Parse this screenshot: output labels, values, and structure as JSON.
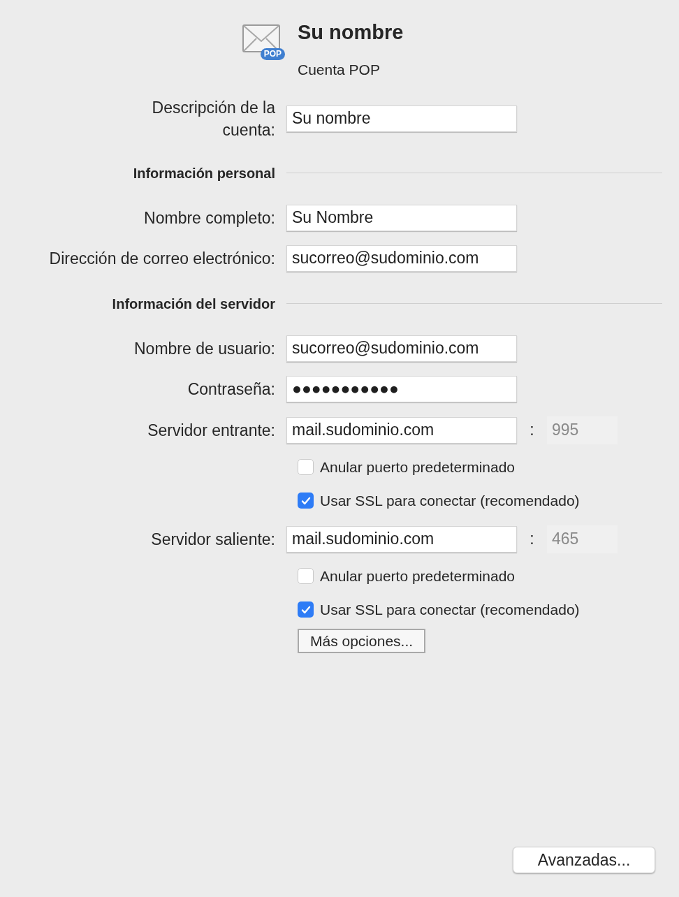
{
  "header": {
    "badge": "POP",
    "title": "Su nombre",
    "subtitle": "Cuenta POP"
  },
  "rows": [
    {
      "kind": "text",
      "label": [
        "Descripción de la",
        "cuenta:"
      ],
      "value": "Su nombre"
    },
    {
      "kind": "section",
      "label": "Información personal"
    },
    {
      "kind": "text",
      "label": [
        "Nombre completo:"
      ],
      "value": "Su Nombre"
    },
    {
      "kind": "text",
      "label": [
        "Dirección de correo electrónico:"
      ],
      "value": "sucorreo@sudominio.com"
    },
    {
      "kind": "section",
      "label": "Información del servidor"
    },
    {
      "kind": "text",
      "label": [
        "Nombre de usuario:"
      ],
      "value": "sucorreo@sudominio.com"
    },
    {
      "kind": "text",
      "label": [
        "Contraseña:"
      ],
      "value": "●●●●●●●●●●●"
    },
    {
      "kind": "server",
      "label": [
        "Servidor entrante:"
      ],
      "value": "mail.sudominio.com",
      "separator": ":",
      "port": "995",
      "port_disabled": true
    },
    {
      "kind": "checkbox",
      "label": "Anular puerto predeterminado",
      "checked": false
    },
    {
      "kind": "checkbox",
      "label": "Usar SSL para conectar (recomendado)",
      "checked": true
    },
    {
      "kind": "server",
      "label": [
        "Servidor saliente:"
      ],
      "value": "mail.sudominio.com",
      "separator": ":",
      "port": "465",
      "port_disabled": true
    },
    {
      "kind": "checkbox",
      "label": "Anular puerto predeterminado",
      "checked": false
    },
    {
      "kind": "checkbox",
      "label": "Usar SSL para conectar (recomendado)",
      "checked": true
    },
    {
      "kind": "button",
      "label": "Más opciones..."
    }
  ],
  "footer_button": "Avanzadas..."
}
